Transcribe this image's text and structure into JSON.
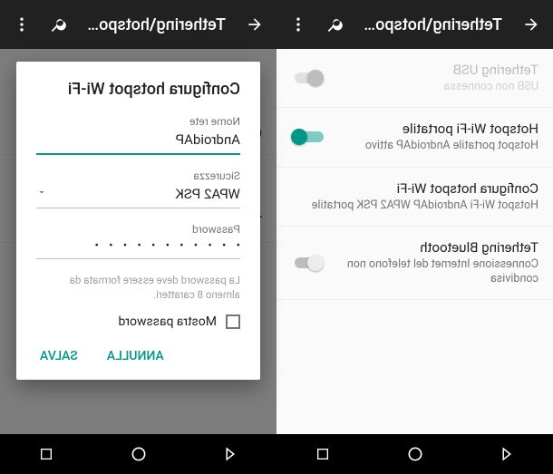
{
  "appbar": {
    "title": "Tethering\\hotspot p..."
  },
  "left_screen": {
    "items": [
      {
        "title": "Tethering USB",
        "sub": "USB non connessa",
        "toggle": "disabled"
      },
      {
        "title": "Hotspot Wi-Fi portatile",
        "sub": "Hotspot portatile AndroidAP attivo",
        "toggle": "on"
      },
      {
        "title": "Configura hotspot Wi-Fi",
        "sub": "Hotspot Wi-Fi AndroidAP WPA2 PSK portatile",
        "toggle": null
      },
      {
        "title": "Tethering Bluetooth",
        "sub": "Connessione Internet del telefono non condivisa",
        "toggle": "off"
      }
    ]
  },
  "right_screen": {
    "peek_labels": [
      "C",
      "T"
    ]
  },
  "dialog": {
    "title": "Configura hotspot Wi-Fi",
    "network_label": "Nome rete",
    "network_value": "AndroidAP",
    "security_label": "Sicurezza",
    "security_value": "WPA2 PSK",
    "password_label": "Password",
    "password_value": "• • • • • • • • • • •",
    "hint": "La password deve essere formata da almeno 8 caratteri.",
    "show_password": "Mostra password",
    "cancel": "ANNULLA",
    "save": "SALVA"
  }
}
